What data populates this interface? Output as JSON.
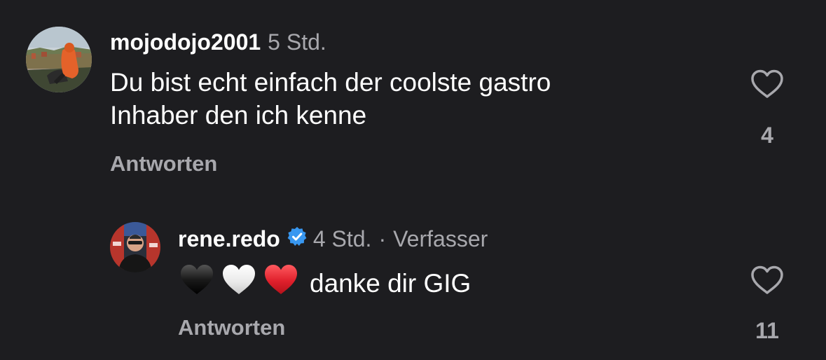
{
  "comments": [
    {
      "username": "mojodojo2001",
      "time": "5 Std.",
      "text_line1": "Du bist echt einfach der coolste gastro",
      "text_line2": "Inhaber den ich kenne",
      "reply_label": "Antworten",
      "likes": "4"
    },
    {
      "username": "rene.redo",
      "verified": true,
      "time": "4 Std.",
      "separator": "·",
      "author_tag": "Verfasser",
      "emojis": [
        "black-heart",
        "white-heart",
        "red-heart"
      ],
      "text": "danke dir GIG",
      "reply_label": "Antworten",
      "likes": "11"
    }
  ],
  "colors": {
    "background": "#1d1d20",
    "primary_text": "#ffffff",
    "secondary_text": "#a8a8ad",
    "verified_badge": "#3897f0",
    "red_heart": "#e0202c"
  }
}
